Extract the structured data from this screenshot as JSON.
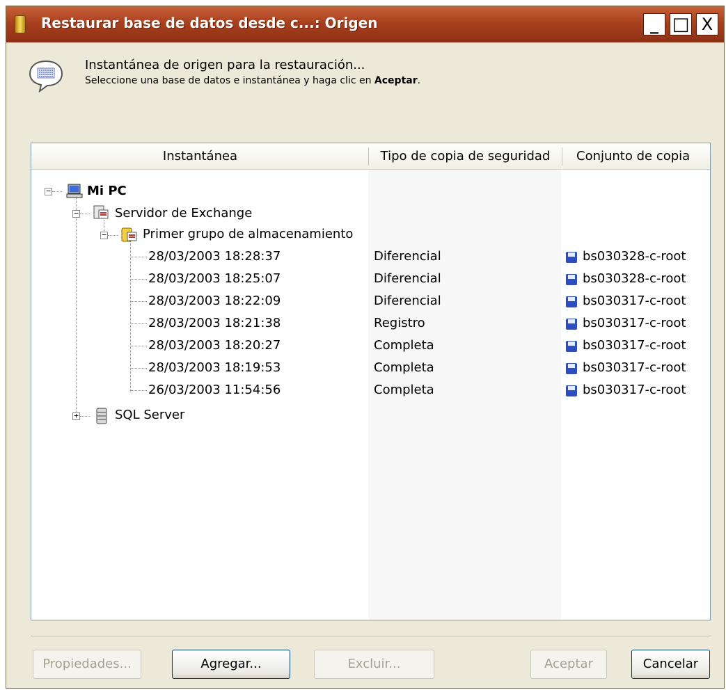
{
  "window": {
    "title": "Restaurar base de datos desde c...: Origen",
    "controls": {
      "minimize": "_",
      "maximize": "□",
      "close": "X"
    }
  },
  "header": {
    "line1": "Instantánea de origen para la restauración...",
    "line2_prefix": "Seleccione una base de datos e instantánea y haga clic en ",
    "line2_bold": "Aceptar",
    "line2_suffix": "."
  },
  "columns": {
    "snapshot": "Instantánea",
    "backup_type": "Tipo de copia de seguridad",
    "backup_set": "Conjunto de copia"
  },
  "tree": {
    "root": {
      "label": "Mi PC",
      "icon": "computer-icon",
      "expander": "−"
    },
    "exchange": {
      "label": "Servidor de Exchange",
      "icon": "exchange-server-icon",
      "expander": "−"
    },
    "storage_group": {
      "label": "Primer grupo de almacenamiento",
      "icon": "storage-group-icon",
      "expander": "−"
    },
    "sql": {
      "label": "SQL Server",
      "icon": "database-icon",
      "expander": "+"
    }
  },
  "snapshots": [
    {
      "date": "28/03/2003 18:28:37",
      "type": "Diferencial",
      "set": "bs030328-c-root"
    },
    {
      "date": "28/03/2003 18:25:07",
      "type": "Diferencial",
      "set": "bs030328-c-root"
    },
    {
      "date": "28/03/2003 18:22:09",
      "type": "Diferencial",
      "set": "bs030317-c-root"
    },
    {
      "date": "28/03/2003 18:21:38",
      "type": "Registro",
      "set": "bs030317-c-root"
    },
    {
      "date": "28/03/2003 18:20:27",
      "type": "Completa",
      "set": "bs030317-c-root"
    },
    {
      "date": "28/03/2003 18:19:53",
      "type": "Completa",
      "set": "bs030317-c-root"
    },
    {
      "date": "26/03/2003 11:54:56",
      "type": "Completa",
      "set": "bs030317-c-root"
    }
  ],
  "buttons": {
    "properties": "Propiedades...",
    "add": "Agregar...",
    "exclude": "Excluir...",
    "accept": "Aceptar",
    "cancel": "Cancelar"
  },
  "colors": {
    "titlebar": "#a8401e",
    "dialog_bg": "#ece9d8",
    "backup_set_icon": "#2a4dbf"
  }
}
